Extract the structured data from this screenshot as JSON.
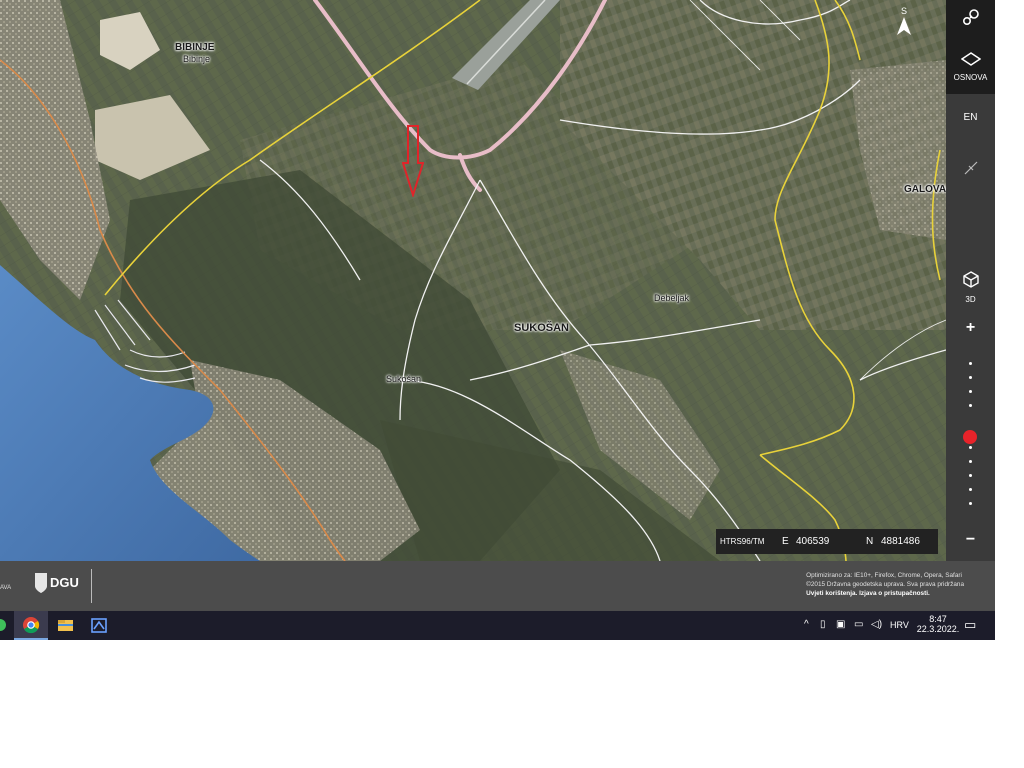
{
  "map": {
    "labels": {
      "bibinje": "BIBINJE",
      "bibinje_sub": "Bibinje",
      "sukosan": "SUKOŠAN",
      "sukosan_sub": "Sukošan",
      "debeljak": "Debeljak",
      "galovac": "GALOVAC"
    },
    "marker": "red-arrow-down",
    "colors": {
      "sea": "#4a78b4",
      "land": "#56604a",
      "boundary": "#e8d23a",
      "road": "#e6b8c4"
    }
  },
  "toolbar": {
    "tools_icon": "tools-icon",
    "layers_label": "OSNOVA",
    "lang_label": "EN",
    "compass_label": "S",
    "view3d_label": "3D",
    "zoom_in": "+",
    "zoom_out": "−",
    "zoom_level_fraction": 0.36
  },
  "coords": {
    "system": "HTRS96/TM",
    "e_label": "E",
    "e_value": "406539",
    "n_label": "N",
    "n_value": "4881486"
  },
  "footer": {
    "left_edge": "AVA",
    "logo_text": "DGU",
    "legal_line1": "Optimizirano za: IE10+, Firefox, Chrome, Opera, Safari",
    "legal_line2": "©2015 Državna geodetska uprava. Sva prava pridržana",
    "legal_link1": "Uvjeti korištenja.",
    "legal_link2": "Izjava o pristupačnosti."
  },
  "taskbar": {
    "apps": [
      "chrome-icon",
      "file-explorer-icon",
      "app-icon"
    ],
    "lang": "HRV",
    "time": "8:47",
    "date": "22.3.2022."
  }
}
